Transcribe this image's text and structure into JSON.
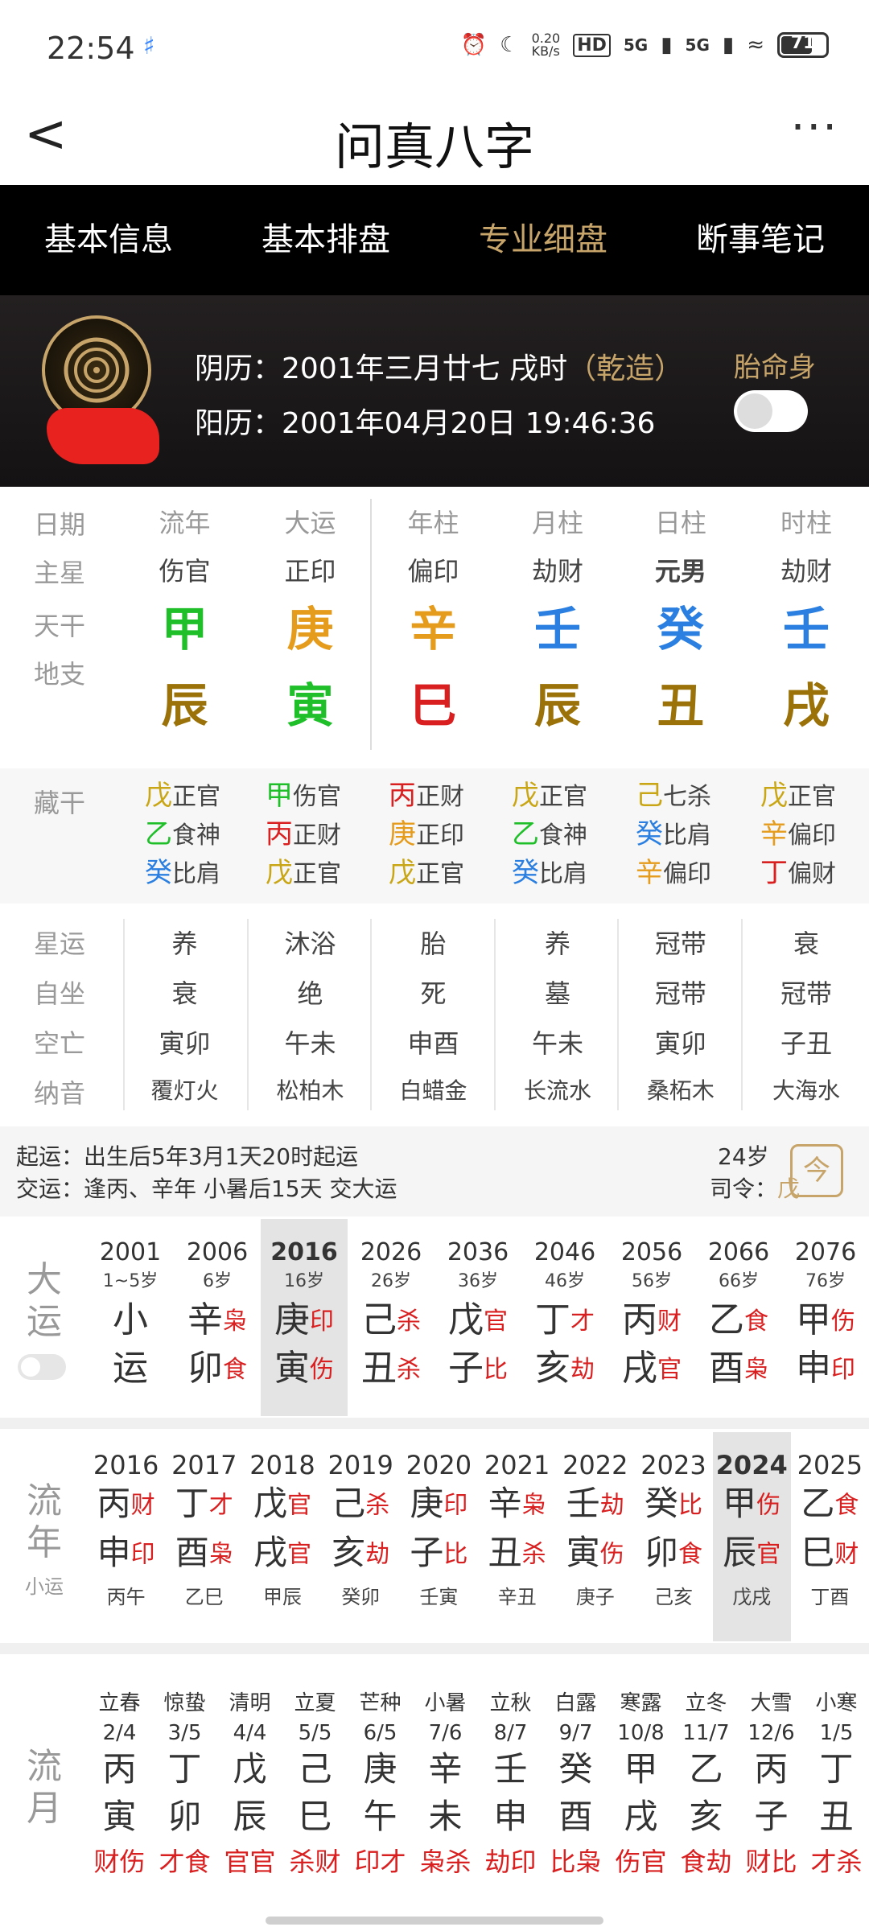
{
  "status": {
    "time": "22:54",
    "net_speed": "0.20\nKB/s",
    "hd": "HD",
    "net1": "5G",
    "net2": "5G",
    "battery": "71"
  },
  "header": {
    "back": "<",
    "title": "问真八字",
    "more": "···"
  },
  "tabs": [
    {
      "label": "基本信息",
      "active": false
    },
    {
      "label": "基本排盘",
      "active": false
    },
    {
      "label": "专业细盘",
      "active": true
    },
    {
      "label": "断事笔记",
      "active": false
    }
  ],
  "profile": {
    "lunar_label": "阴历：",
    "lunar_date": "2001年三月廿七 戌时",
    "qianzao": "（乾造）",
    "solar_label": "阳历：",
    "solar_date": "2001年04月20日 19:46:36",
    "taimingshen": "胎命身"
  },
  "pillars": {
    "row_labels": [
      "日期",
      "主星",
      "天干",
      "地支"
    ],
    "columns": [
      {
        "head": "流年",
        "star": "伤官",
        "gan": "甲",
        "gan_color": "#1fbf2a",
        "zhi": "辰",
        "zhi_color": "#9a7209"
      },
      {
        "head": "大运",
        "star": "正印",
        "gan": "庚",
        "gan_color": "#e59b1c",
        "zhi": "寅",
        "zhi_color": "#1fbf2a"
      },
      {
        "head": "年柱",
        "star": "偏印",
        "gan": "辛",
        "gan_color": "#e59b1c",
        "zhi": "巳",
        "zhi_color": "#d91f1f"
      },
      {
        "head": "月柱",
        "star": "劫财",
        "gan": "壬",
        "gan_color": "#2a7fe0",
        "zhi": "辰",
        "zhi_color": "#9a7209"
      },
      {
        "head": "日柱",
        "star": "元男",
        "gan": "癸",
        "gan_color": "#2a7fe0",
        "zhi": "丑",
        "zhi_color": "#9a7209"
      },
      {
        "head": "时柱",
        "star": "劫财",
        "gan": "壬",
        "gan_color": "#2a7fe0",
        "zhi": "戌",
        "zhi_color": "#9a7209"
      }
    ]
  },
  "canggan": {
    "label": "藏干",
    "columns": [
      [
        {
          "g": "戊",
          "c": "#c9a616",
          "s": "正官"
        },
        {
          "g": "乙",
          "c": "#1fbf2a",
          "s": "食神"
        },
        {
          "g": "癸",
          "c": "#2a7fe0",
          "s": "比肩"
        }
      ],
      [
        {
          "g": "甲",
          "c": "#1fbf2a",
          "s": "伤官"
        },
        {
          "g": "丙",
          "c": "#d91f1f",
          "s": "正财"
        },
        {
          "g": "戊",
          "c": "#c9a616",
          "s": "正官"
        }
      ],
      [
        {
          "g": "丙",
          "c": "#d91f1f",
          "s": "正财"
        },
        {
          "g": "庚",
          "c": "#e59b1c",
          "s": "正印"
        },
        {
          "g": "戊",
          "c": "#c9a616",
          "s": "正官"
        }
      ],
      [
        {
          "g": "戊",
          "c": "#c9a616",
          "s": "正官"
        },
        {
          "g": "乙",
          "c": "#1fbf2a",
          "s": "食神"
        },
        {
          "g": "癸",
          "c": "#2a7fe0",
          "s": "比肩"
        }
      ],
      [
        {
          "g": "己",
          "c": "#c9a616",
          "s": "七杀"
        },
        {
          "g": "癸",
          "c": "#2a7fe0",
          "s": "比肩"
        },
        {
          "g": "辛",
          "c": "#e59b1c",
          "s": "偏印"
        }
      ],
      [
        {
          "g": "戊",
          "c": "#c9a616",
          "s": "正官"
        },
        {
          "g": "辛",
          "c": "#e59b1c",
          "s": "偏印"
        },
        {
          "g": "丁",
          "c": "#d91f1f",
          "s": "偏财"
        }
      ]
    ]
  },
  "props": {
    "row_labels": [
      "星运",
      "自坐",
      "空亡",
      "纳音"
    ],
    "columns": [
      [
        "养",
        "衰",
        "寅卯",
        "覆灯火"
      ],
      [
        "沐浴",
        "绝",
        "午未",
        "松柏木"
      ],
      [
        "胎",
        "死",
        "申酉",
        "白蜡金"
      ],
      [
        "养",
        "墓",
        "午未",
        "长流水"
      ],
      [
        "冠带",
        "冠带",
        "寅卯",
        "桑柘木"
      ],
      [
        "衰",
        "冠带",
        "子丑",
        "大海水"
      ]
    ]
  },
  "qiyun": {
    "line1_label": "起运：",
    "line1": "出生后5年3月1天20时起运",
    "line2_label": "交运：",
    "line2": "逢丙、辛年 小暑后15天 交大运",
    "age": "24岁",
    "siling_label": "司令：",
    "siling": "戊",
    "cal_icon": "今"
  },
  "dayun": {
    "label": "大运",
    "items": [
      {
        "year": "2001",
        "age": "1~5岁",
        "g": "小",
        "gs": "",
        "z": "运",
        "zs": "",
        "hl": false
      },
      {
        "year": "2006",
        "age": "6岁",
        "g": "辛",
        "gs": "枭",
        "z": "卯",
        "zs": "食",
        "hl": false
      },
      {
        "year": "2016",
        "age": "16岁",
        "g": "庚",
        "gs": "印",
        "z": "寅",
        "zs": "伤",
        "hl": true
      },
      {
        "year": "2026",
        "age": "26岁",
        "g": "己",
        "gs": "杀",
        "z": "丑",
        "zs": "杀",
        "hl": false
      },
      {
        "year": "2036",
        "age": "36岁",
        "g": "戊",
        "gs": "官",
        "z": "子",
        "zs": "比",
        "hl": false
      },
      {
        "year": "2046",
        "age": "46岁",
        "g": "丁",
        "gs": "才",
        "z": "亥",
        "zs": "劫",
        "hl": false
      },
      {
        "year": "2056",
        "age": "56岁",
        "g": "丙",
        "gs": "财",
        "z": "戌",
        "zs": "官",
        "hl": false
      },
      {
        "year": "2066",
        "age": "66岁",
        "g": "乙",
        "gs": "食",
        "z": "酉",
        "zs": "枭",
        "hl": false
      },
      {
        "year": "2076",
        "age": "76岁",
        "g": "甲",
        "gs": "伤",
        "z": "申",
        "zs": "印",
        "hl": false
      }
    ]
  },
  "liunian": {
    "label": "流年",
    "sublabel": "小运",
    "items": [
      {
        "year": "2016",
        "g": "丙",
        "gs": "财",
        "z": "申",
        "zs": "印",
        "xy": "丙午",
        "hl": false
      },
      {
        "year": "2017",
        "g": "丁",
        "gs": "才",
        "z": "酉",
        "zs": "枭",
        "xy": "乙巳",
        "hl": false
      },
      {
        "year": "2018",
        "g": "戊",
        "gs": "官",
        "z": "戌",
        "zs": "官",
        "xy": "甲辰",
        "hl": false
      },
      {
        "year": "2019",
        "g": "己",
        "gs": "杀",
        "z": "亥",
        "zs": "劫",
        "xy": "癸卯",
        "hl": false
      },
      {
        "year": "2020",
        "g": "庚",
        "gs": "印",
        "z": "子",
        "zs": "比",
        "xy": "壬寅",
        "hl": false
      },
      {
        "year": "2021",
        "g": "辛",
        "gs": "枭",
        "z": "丑",
        "zs": "杀",
        "xy": "辛丑",
        "hl": false
      },
      {
        "year": "2022",
        "g": "壬",
        "gs": "劫",
        "z": "寅",
        "zs": "伤",
        "xy": "庚子",
        "hl": false
      },
      {
        "year": "2023",
        "g": "癸",
        "gs": "比",
        "z": "卯",
        "zs": "食",
        "xy": "己亥",
        "hl": false
      },
      {
        "year": "2024",
        "g": "甲",
        "gs": "伤",
        "z": "辰",
        "zs": "官",
        "xy": "戊戌",
        "hl": true
      },
      {
        "year": "2025",
        "g": "乙",
        "gs": "食",
        "z": "巳",
        "zs": "财",
        "xy": "丁酉",
        "hl": false
      }
    ]
  },
  "liuyue": {
    "label": "流月",
    "items": [
      {
        "jq": "立春",
        "d": "2/4",
        "g": "丙",
        "z": "寅",
        "ss": "财伤"
      },
      {
        "jq": "惊蛰",
        "d": "3/5",
        "g": "丁",
        "z": "卯",
        "ss": "才食"
      },
      {
        "jq": "清明",
        "d": "4/4",
        "g": "戊",
        "z": "辰",
        "ss": "官官"
      },
      {
        "jq": "立夏",
        "d": "5/5",
        "g": "己",
        "z": "巳",
        "ss": "杀财"
      },
      {
        "jq": "芒种",
        "d": "6/5",
        "g": "庚",
        "z": "午",
        "ss": "印才"
      },
      {
        "jq": "小暑",
        "d": "7/6",
        "g": "辛",
        "z": "未",
        "ss": "枭杀"
      },
      {
        "jq": "立秋",
        "d": "8/7",
        "g": "壬",
        "z": "申",
        "ss": "劫印"
      },
      {
        "jq": "白露",
        "d": "9/7",
        "g": "癸",
        "z": "酉",
        "ss": "比枭"
      },
      {
        "jq": "寒露",
        "d": "10/8",
        "g": "甲",
        "z": "戌",
        "ss": "伤官"
      },
      {
        "jq": "立冬",
        "d": "11/7",
        "g": "乙",
        "z": "亥",
        "ss": "食劫"
      },
      {
        "jq": "大雪",
        "d": "12/6",
        "g": "丙",
        "z": "子",
        "ss": "财比"
      },
      {
        "jq": "小寒",
        "d": "1/5",
        "g": "丁",
        "z": "丑",
        "ss": "才杀"
      }
    ]
  }
}
